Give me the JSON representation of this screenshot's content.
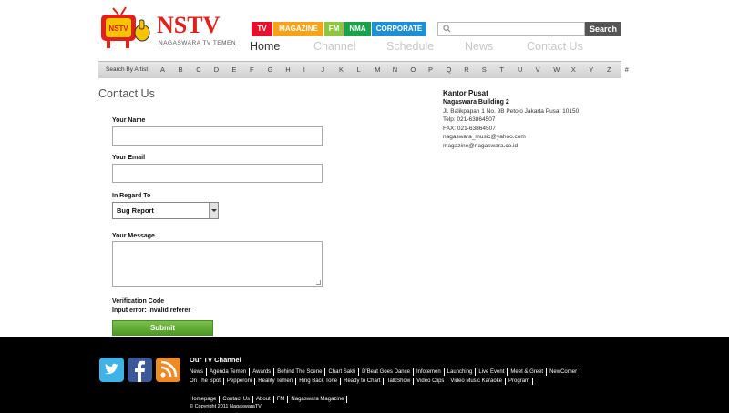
{
  "brand": {
    "name": "NSTV",
    "tagline": "NAGASWARA TV TEMEN",
    "tv_colors": {
      "red": "#e0201c",
      "yellow": "#f6c400"
    }
  },
  "category_tabs": [
    {
      "label": "TV",
      "color": "#e8112d"
    },
    {
      "label": "MAGAZINE",
      "color": "#f7a21b"
    },
    {
      "label": "FM",
      "color": "#8fc641"
    },
    {
      "label": "NMA",
      "color": "#18a34a"
    },
    {
      "label": "CORPORATE",
      "color": "#1e8fd3"
    }
  ],
  "search": {
    "placeholder": "",
    "button_label": "Search",
    "icon": "search-icon"
  },
  "main_nav": [
    {
      "label": "Home",
      "active": true
    },
    {
      "label": "Channel",
      "active": false
    },
    {
      "label": "Schedule",
      "active": false
    },
    {
      "label": "News",
      "active": false
    },
    {
      "label": "Contact Us",
      "active": false
    }
  ],
  "alpha_bar": {
    "label": "Search By Artist",
    "letters": [
      "A",
      "B",
      "C",
      "D",
      "E",
      "F",
      "G",
      "H",
      "I",
      "J",
      "K",
      "L",
      "M",
      "N",
      "O",
      "P",
      "Q",
      "R",
      "S",
      "T",
      "U",
      "V",
      "W",
      "X",
      "Y",
      "Z",
      "#"
    ]
  },
  "page_title": "Contact Us",
  "form": {
    "name_label": "Your Name",
    "email_label": "Your Email",
    "regard_label": "In Regard To",
    "regard_value": "Bug Report",
    "message_label": "Your Message",
    "verification_label": "Verification Code",
    "error_text": "Input error: Invalid referer",
    "submit_label": "Submit"
  },
  "office": {
    "title": "Kantor Pusat",
    "building": "Nagaswara Building 2",
    "address": "Jl. Balikpapan 1 No. 9B Petojo Jakarta Pusat 10150",
    "phone": "Telp: 021-63864507",
    "fax": "FAX: 021-63864507",
    "email1": "nagaswara_music@yahoo.com",
    "email2": "magazine@nagaswara.co.id"
  },
  "footer": {
    "social": [
      {
        "name": "twitter-icon",
        "color": "#3fb2e6"
      },
      {
        "name": "facebook-icon",
        "color": "#3b5998"
      },
      {
        "name": "rss-icon",
        "color": "#f08a24"
      }
    ],
    "channel_title": "Our TV Channel",
    "channels_row1": [
      "News",
      "Agenda Temen",
      "Awards",
      "Behind The Scene",
      "Chart Sakti",
      "D'Beat Goes Dance",
      "Infotemen",
      "Launching",
      "Live Event",
      "Meet & Greet",
      "NewComer"
    ],
    "channels_row2": [
      "On The Spot",
      "Pepperoni",
      "Reality Temen",
      "Ring Back Tone",
      "Ready to Chart",
      "TalkShow",
      "Video Clips",
      "Video Music Karaoke",
      "Program"
    ],
    "bottom_links": [
      "Homepage",
      "Contact Us",
      "About",
      "FM",
      "Nagaswara Magazine"
    ],
    "copyright": "© Copyright 2011 NagaswaraTV"
  }
}
